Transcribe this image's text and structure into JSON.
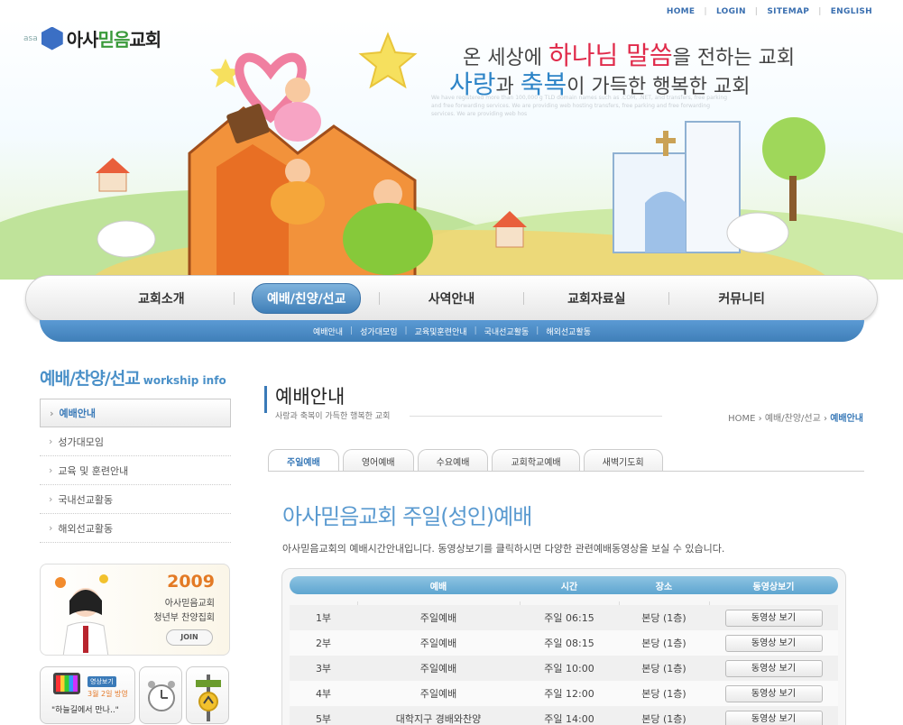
{
  "toplinks": [
    "HOME",
    "LOGIN",
    "SITEMAP",
    "ENGLISH"
  ],
  "logo": {
    "prefix": "asa",
    "name_a": "아사",
    "name_b": "믿음",
    "name_c": "교회"
  },
  "hero": {
    "slogan1_pre": "온 세상에 ",
    "slogan1_hl": "하나님 말씀",
    "slogan1_post": "을 전하는 교회",
    "slogan2_hl1": "사랑",
    "slogan2_mid": "과 ",
    "slogan2_hl2": "축복",
    "slogan2_post": "이 가득한 행복한 교회",
    "filler": "We have registered more than 100,000 g TLD domain names such as .COM, .NET, and transfers, free parking and free forwarding services. We are providing web hosting transfers, free parking and free forwarding services. We are providing web hos"
  },
  "nav": {
    "items": [
      "교회소개",
      "예배/친양/선교",
      "사역안내",
      "교회자료실",
      "커뮤니티"
    ],
    "active_index": 1
  },
  "subnav": [
    "예배안내",
    "성가대모임",
    "교육및훈련안내",
    "국내선교활동",
    "해외선교활동"
  ],
  "leftnav": {
    "title": "예배/찬양/선교",
    "title_en": "workship info",
    "items": [
      "예배안내",
      "성가대모임",
      "교육 및 훈련안내",
      "국내선교활동",
      "해외선교활동"
    ],
    "active_index": 0
  },
  "promo": {
    "year": "2009",
    "line1": "아사믿음교회",
    "line2": "청년부 찬양집회",
    "join": "JOIN"
  },
  "tvbox": {
    "badge": "영상보기",
    "date": "3월 2일 방영",
    "caption": "\"하늘길에서 만나..\""
  },
  "content": {
    "title": "예배안내",
    "subtitle": "사랑과 축복이 가득한 행복한 교회",
    "breadcrumb": {
      "home": "HOME",
      "section": "예배/찬양/선교",
      "current": "예배안내"
    },
    "tabs": [
      "주일예배",
      "영어예배",
      "수요예배",
      "교회학교예배",
      "새벽기도회"
    ],
    "active_tab": 0,
    "worship_title": "아사믿음교회 주일(성인)예배",
    "worship_desc": "아사믿음교회의 예배시간안내입니다. 동영상보기를 클릭하시면 다양한 관련예배동영상을 보실 수 있습니다.",
    "table": {
      "headers": [
        "예배",
        "시간",
        "장소",
        "동영상보기"
      ],
      "rows": [
        {
          "part": "1부",
          "service": "주일예배",
          "time": "주일 06:15",
          "place": "본당 (1층)",
          "video": "동영상 보기"
        },
        {
          "part": "2부",
          "service": "주일예배",
          "time": "주일 08:15",
          "place": "본당 (1층)",
          "video": "동영상 보기"
        },
        {
          "part": "3부",
          "service": "주일예배",
          "time": "주일 10:00",
          "place": "본당 (1층)",
          "video": "동영상 보기"
        },
        {
          "part": "4부",
          "service": "주일예배",
          "time": "주일 12:00",
          "place": "본당 (1층)",
          "video": "동영상 보기"
        },
        {
          "part": "5부",
          "service": "대학지구 경배와찬양",
          "time": "주일 14:00",
          "place": "본당 (1층)",
          "video": "동영상 보기"
        }
      ]
    }
  },
  "colors": {
    "accent_blue": "#3a7ab8",
    "title_blue": "#5a9ad0",
    "slogan_red": "#e02a4a",
    "promo_orange": "#e37a25"
  }
}
